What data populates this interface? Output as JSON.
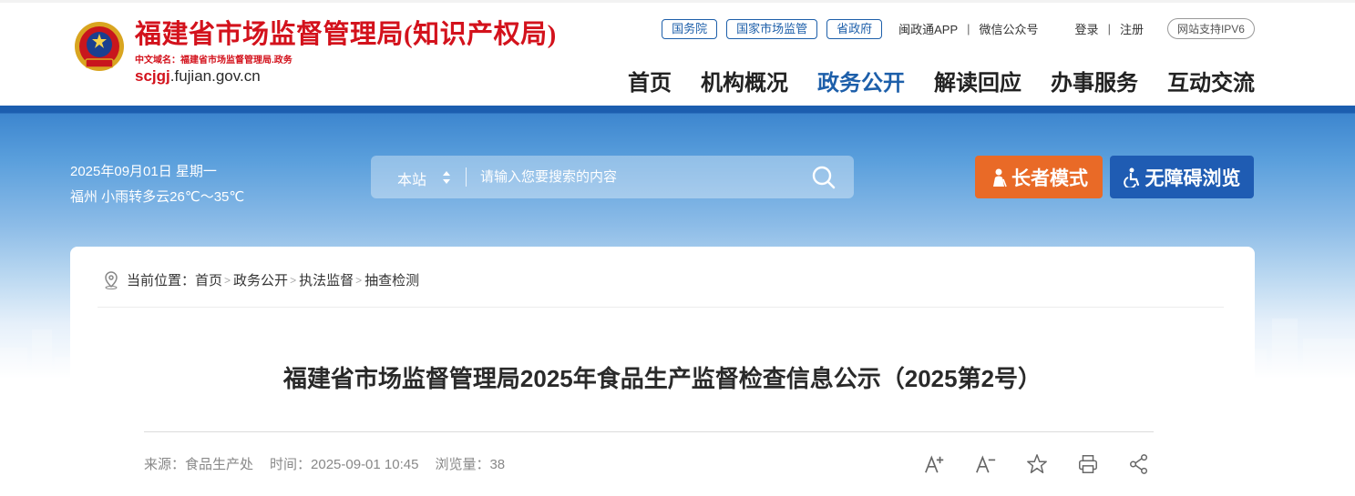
{
  "header": {
    "site_title": "福建省市场监督管理局(知识产权局)",
    "cn_domain": "中文域名：福建省市场监督管理局.政务",
    "en_domain_bold": "scjgj",
    "en_domain_rest": ".fujian.gov.cn",
    "top_pills": [
      "国务院",
      "国家市场监管",
      "省政府"
    ],
    "app_link": "闽政通APP",
    "wechat_link": "微信公众号",
    "login": "登录",
    "register": "注册",
    "ipv6": "网站支持IPV6",
    "nav": [
      "首页",
      "机构概况",
      "政务公开",
      "解读回应",
      "办事服务",
      "互动交流"
    ],
    "active_nav": "政务公开"
  },
  "banner": {
    "date": "2025年09月01日 星期一",
    "weather": "福州 小雨转多云26℃～35℃",
    "search_scope": "本站",
    "search_placeholder": "请输入您要搜索的内容",
    "elder_mode": "长者模式",
    "accessible": "无障碍浏览"
  },
  "breadcrumb": {
    "prefix": "当前位置：",
    "items": [
      "首页",
      "政务公开",
      "执法监督",
      "抽查检测"
    ]
  },
  "article": {
    "title": "福建省市场监督管理局2025年食品生产监督检查信息公示（2025第2号）",
    "source": "来源：食品生产处",
    "time": "时间：2025-09-01 10:45",
    "views": "浏览量：38"
  },
  "colors": {
    "brand_red": "#d3121c",
    "brand_blue": "#1d5faa",
    "elder_orange": "#e96a27",
    "access_blue": "#1f5cb3"
  },
  "icons": [
    "emblem-icon",
    "sort-arrows-icon",
    "search-icon",
    "elder-icon",
    "wheelchair-icon",
    "location-pin-icon",
    "font-increase-icon",
    "font-decrease-icon",
    "star-icon",
    "print-icon",
    "share-icon"
  ]
}
